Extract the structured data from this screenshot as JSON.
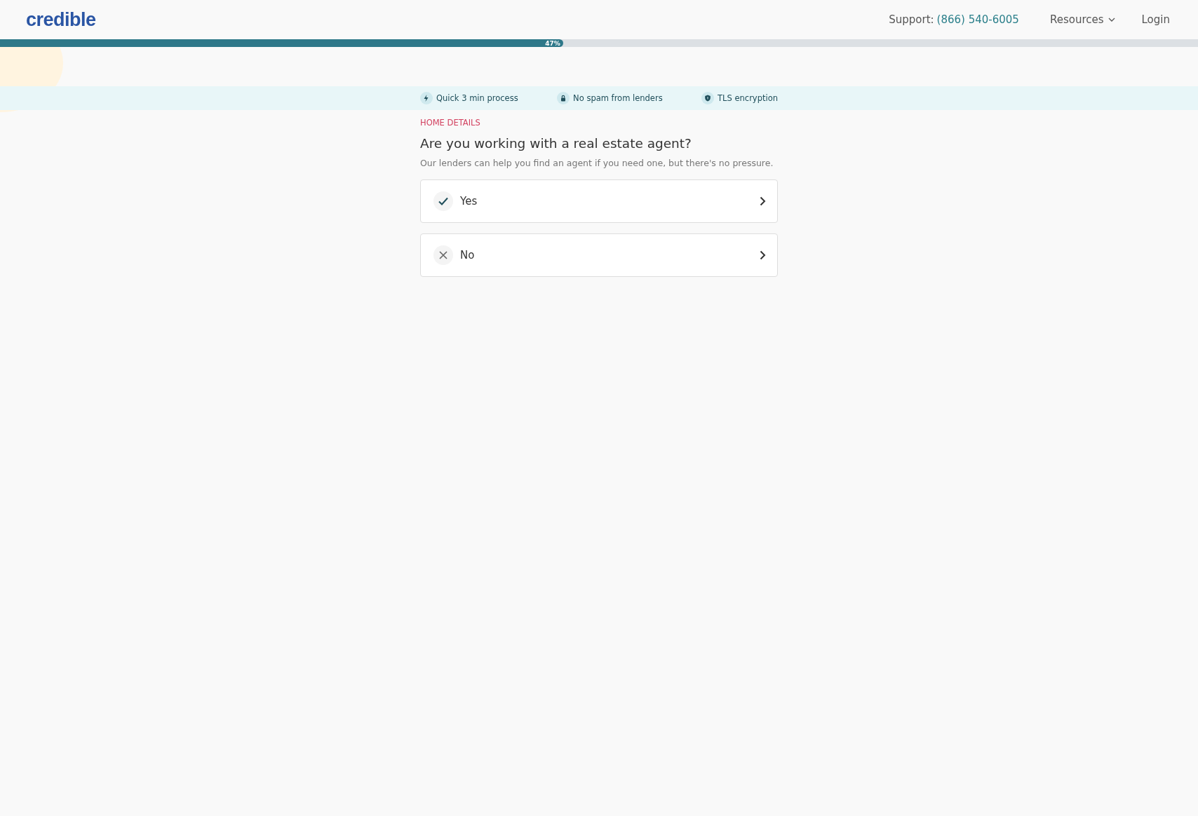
{
  "header": {
    "logo": "credible",
    "support_label": "Support:",
    "support_phone": "(866) 540-6005",
    "nav": [
      {
        "label": "Resources",
        "kind": "dropdown"
      },
      {
        "label": "Login",
        "kind": "link"
      }
    ]
  },
  "progress": {
    "level": 0.47,
    "label": "47%"
  },
  "features": [
    {
      "kind": "speed",
      "label": "Quick 3 min process"
    },
    {
      "kind": "privacy",
      "label": "No spam from lenders"
    },
    {
      "kind": "security",
      "label": "TLS encryption"
    }
  ],
  "section": "HOME DETAILS",
  "question": "Are you working with a real estate agent?",
  "hint": "Our lenders can help you find an agent if you need one, but there's no pressure.",
  "options": [
    {
      "kind": "yes",
      "label": "Yes"
    },
    {
      "kind": "no",
      "label": "No"
    }
  ]
}
